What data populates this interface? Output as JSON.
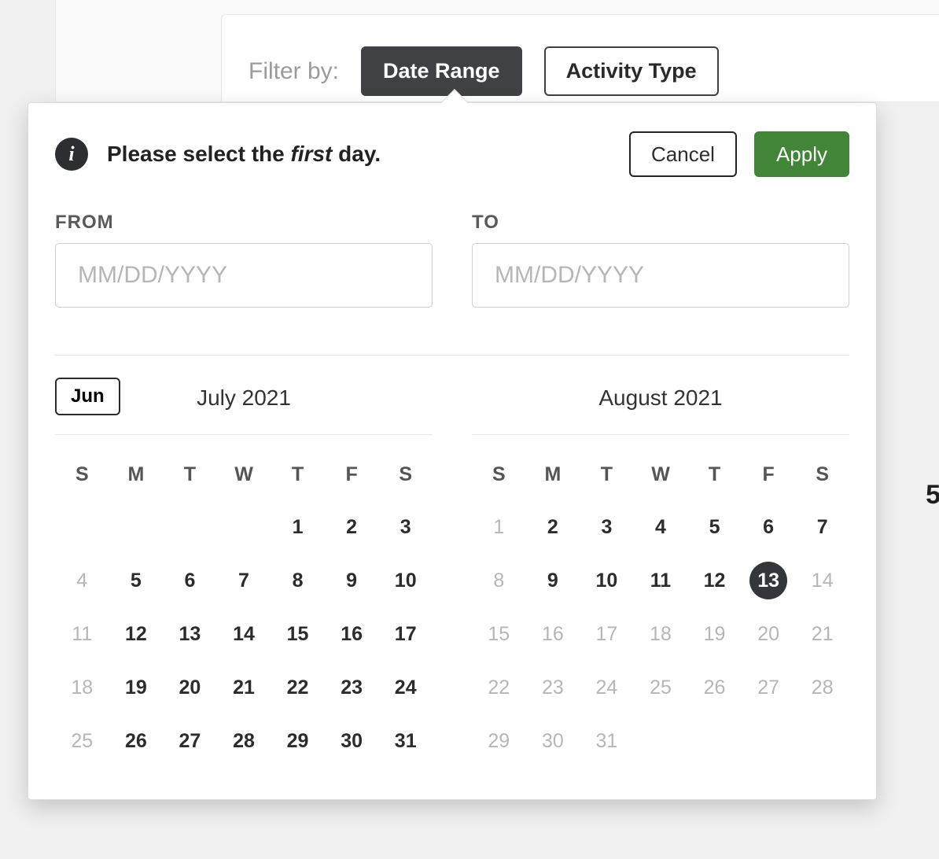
{
  "filterbar": {
    "label": "Filter by:",
    "tabs": {
      "date_range": "Date Range",
      "activity_type": "Activity Type"
    }
  },
  "popover": {
    "hint_prefix": "Please select the ",
    "hint_em": "first",
    "hint_suffix": " day.",
    "cancel": "Cancel",
    "apply": "Apply",
    "from_label": "FROM",
    "to_label": "TO",
    "from_placeholder": "MM/DD/YYYY",
    "to_placeholder": "MM/DD/YYYY",
    "from_value": "",
    "to_value": ""
  },
  "weekdays": [
    "S",
    "M",
    "T",
    "W",
    "T",
    "F",
    "S"
  ],
  "calendars": {
    "prev_month_btn": "Jun",
    "left": {
      "title": "July 2021",
      "weeks": [
        [
          {
            "n": "",
            "k": "empty"
          },
          {
            "n": "",
            "k": "empty"
          },
          {
            "n": "",
            "k": "empty"
          },
          {
            "n": "",
            "k": "empty"
          },
          {
            "n": "1",
            "k": ""
          },
          {
            "n": "2",
            "k": ""
          },
          {
            "n": "3",
            "k": ""
          }
        ],
        [
          {
            "n": "4",
            "k": "dim"
          },
          {
            "n": "5",
            "k": ""
          },
          {
            "n": "6",
            "k": ""
          },
          {
            "n": "7",
            "k": ""
          },
          {
            "n": "8",
            "k": ""
          },
          {
            "n": "9",
            "k": ""
          },
          {
            "n": "10",
            "k": ""
          }
        ],
        [
          {
            "n": "11",
            "k": "dim"
          },
          {
            "n": "12",
            "k": ""
          },
          {
            "n": "13",
            "k": ""
          },
          {
            "n": "14",
            "k": ""
          },
          {
            "n": "15",
            "k": ""
          },
          {
            "n": "16",
            "k": ""
          },
          {
            "n": "17",
            "k": ""
          }
        ],
        [
          {
            "n": "18",
            "k": "dim"
          },
          {
            "n": "19",
            "k": ""
          },
          {
            "n": "20",
            "k": ""
          },
          {
            "n": "21",
            "k": ""
          },
          {
            "n": "22",
            "k": ""
          },
          {
            "n": "23",
            "k": ""
          },
          {
            "n": "24",
            "k": ""
          }
        ],
        [
          {
            "n": "25",
            "k": "dim"
          },
          {
            "n": "26",
            "k": ""
          },
          {
            "n": "27",
            "k": ""
          },
          {
            "n": "28",
            "k": ""
          },
          {
            "n": "29",
            "k": ""
          },
          {
            "n": "30",
            "k": ""
          },
          {
            "n": "31",
            "k": ""
          }
        ]
      ]
    },
    "right": {
      "title": "August 2021",
      "weeks": [
        [
          {
            "n": "1",
            "k": "dim"
          },
          {
            "n": "2",
            "k": ""
          },
          {
            "n": "3",
            "k": ""
          },
          {
            "n": "4",
            "k": ""
          },
          {
            "n": "5",
            "k": ""
          },
          {
            "n": "6",
            "k": ""
          },
          {
            "n": "7",
            "k": ""
          }
        ],
        [
          {
            "n": "8",
            "k": "dim"
          },
          {
            "n": "9",
            "k": ""
          },
          {
            "n": "10",
            "k": ""
          },
          {
            "n": "11",
            "k": ""
          },
          {
            "n": "12",
            "k": ""
          },
          {
            "n": "13",
            "k": "today"
          },
          {
            "n": "14",
            "k": "dim"
          }
        ],
        [
          {
            "n": "15",
            "k": "dim"
          },
          {
            "n": "16",
            "k": "dim"
          },
          {
            "n": "17",
            "k": "dim"
          },
          {
            "n": "18",
            "k": "dim"
          },
          {
            "n": "19",
            "k": "dim"
          },
          {
            "n": "20",
            "k": "dim"
          },
          {
            "n": "21",
            "k": "dim"
          }
        ],
        [
          {
            "n": "22",
            "k": "dim"
          },
          {
            "n": "23",
            "k": "dim"
          },
          {
            "n": "24",
            "k": "dim"
          },
          {
            "n": "25",
            "k": "dim"
          },
          {
            "n": "26",
            "k": "dim"
          },
          {
            "n": "27",
            "k": "dim"
          },
          {
            "n": "28",
            "k": "dim"
          }
        ],
        [
          {
            "n": "29",
            "k": "dim"
          },
          {
            "n": "30",
            "k": "dim"
          },
          {
            "n": "31",
            "k": "dim"
          },
          {
            "n": "",
            "k": "empty"
          },
          {
            "n": "",
            "k": "empty"
          },
          {
            "n": "",
            "k": "empty"
          },
          {
            "n": "",
            "k": "empty"
          }
        ]
      ]
    }
  },
  "background_glimpse": "5"
}
